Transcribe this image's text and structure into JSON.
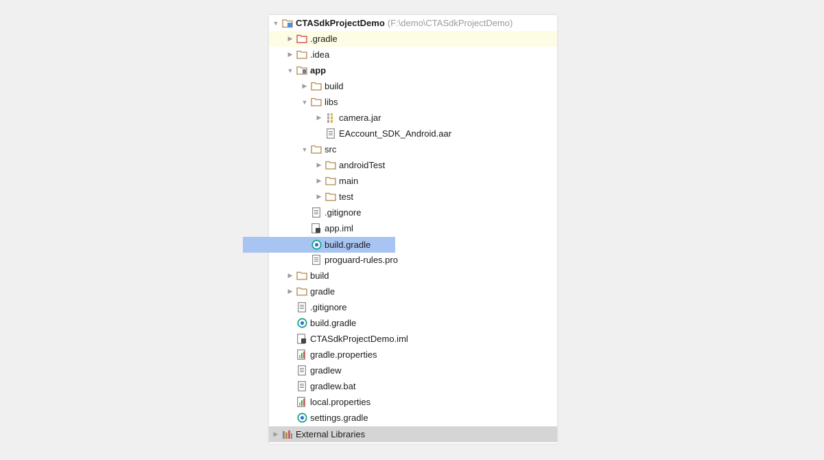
{
  "project": {
    "name": "CTASdkProjectDemo",
    "path": "(F:\\demo\\CTASdkProjectDemo)"
  },
  "tree": [
    {
      "id": "gradle-dir",
      "label": ".gradle",
      "depth": 1,
      "arrow": "right",
      "icon": "folder-red-icon"
    },
    {
      "id": "idea-dir",
      "label": ".idea",
      "depth": 1,
      "arrow": "right",
      "icon": "folder-icon"
    },
    {
      "id": "app-module",
      "label": "app",
      "depth": 1,
      "arrow": "down",
      "icon": "module-folder-icon",
      "bold": true
    },
    {
      "id": "app-build-dir",
      "label": "build",
      "depth": 2,
      "arrow": "right",
      "icon": "folder-icon"
    },
    {
      "id": "libs-dir",
      "label": "libs",
      "depth": 2,
      "arrow": "down",
      "icon": "folder-icon"
    },
    {
      "id": "camera-jar",
      "label": "camera.jar",
      "depth": 3,
      "arrow": "right",
      "icon": "jar-icon"
    },
    {
      "id": "eaccount-aar",
      "label": "EAccount_SDK_Android.aar",
      "depth": 3,
      "arrow": "none",
      "icon": "file-text-icon"
    },
    {
      "id": "src-dir",
      "label": "src",
      "depth": 2,
      "arrow": "down",
      "icon": "folder-icon"
    },
    {
      "id": "androidtest-dir",
      "label": "androidTest",
      "depth": 3,
      "arrow": "right",
      "icon": "folder-icon"
    },
    {
      "id": "main-dir",
      "label": "main",
      "depth": 3,
      "arrow": "right",
      "icon": "folder-icon"
    },
    {
      "id": "test-dir",
      "label": "test",
      "depth": 3,
      "arrow": "right",
      "icon": "folder-icon"
    },
    {
      "id": "app-gitignore",
      "label": ".gitignore",
      "depth": 2,
      "arrow": "none",
      "icon": "file-text-icon"
    },
    {
      "id": "app-iml",
      "label": "app.iml",
      "depth": 2,
      "arrow": "none",
      "icon": "iml-file-icon"
    },
    {
      "id": "app-build-gradle",
      "label": "build.gradle",
      "depth": 2,
      "arrow": "none",
      "icon": "gradle-icon",
      "selected": true
    },
    {
      "id": "proguard-rules",
      "label": "proguard-rules.pro",
      "depth": 2,
      "arrow": "none",
      "icon": "file-text-icon"
    },
    {
      "id": "root-build-dir",
      "label": "build",
      "depth": 1,
      "arrow": "right",
      "icon": "folder-icon"
    },
    {
      "id": "root-gradle-dir",
      "label": "gradle",
      "depth": 1,
      "arrow": "right",
      "icon": "folder-icon"
    },
    {
      "id": "root-gitignore",
      "label": ".gitignore",
      "depth": 1,
      "arrow": "none",
      "icon": "file-text-icon"
    },
    {
      "id": "root-build-gradle",
      "label": "build.gradle",
      "depth": 1,
      "arrow": "none",
      "icon": "gradle-icon"
    },
    {
      "id": "project-iml",
      "label": "CTASdkProjectDemo.iml",
      "depth": 1,
      "arrow": "none",
      "icon": "iml-file-icon"
    },
    {
      "id": "gradle-properties",
      "label": "gradle.properties",
      "depth": 1,
      "arrow": "none",
      "icon": "properties-icon"
    },
    {
      "id": "gradlew",
      "label": "gradlew",
      "depth": 1,
      "arrow": "none",
      "icon": "file-text-icon"
    },
    {
      "id": "gradlew-bat",
      "label": "gradlew.bat",
      "depth": 1,
      "arrow": "none",
      "icon": "file-text-icon"
    },
    {
      "id": "local-properties",
      "label": "local.properties",
      "depth": 1,
      "arrow": "none",
      "icon": "properties-icon"
    },
    {
      "id": "settings-gradle",
      "label": "settings.gradle",
      "depth": 1,
      "arrow": "none",
      "icon": "gradle-icon"
    }
  ],
  "external_libraries": {
    "label": "External Libraries",
    "icon": "library-icon"
  },
  "colors": {
    "selection": "#a8c4f2",
    "hover_row": "#fdfce4",
    "footer_row": "#d5d5d5",
    "folder": "#b0874a",
    "folder_red": "#d9534f",
    "gradle": "#17a589"
  }
}
